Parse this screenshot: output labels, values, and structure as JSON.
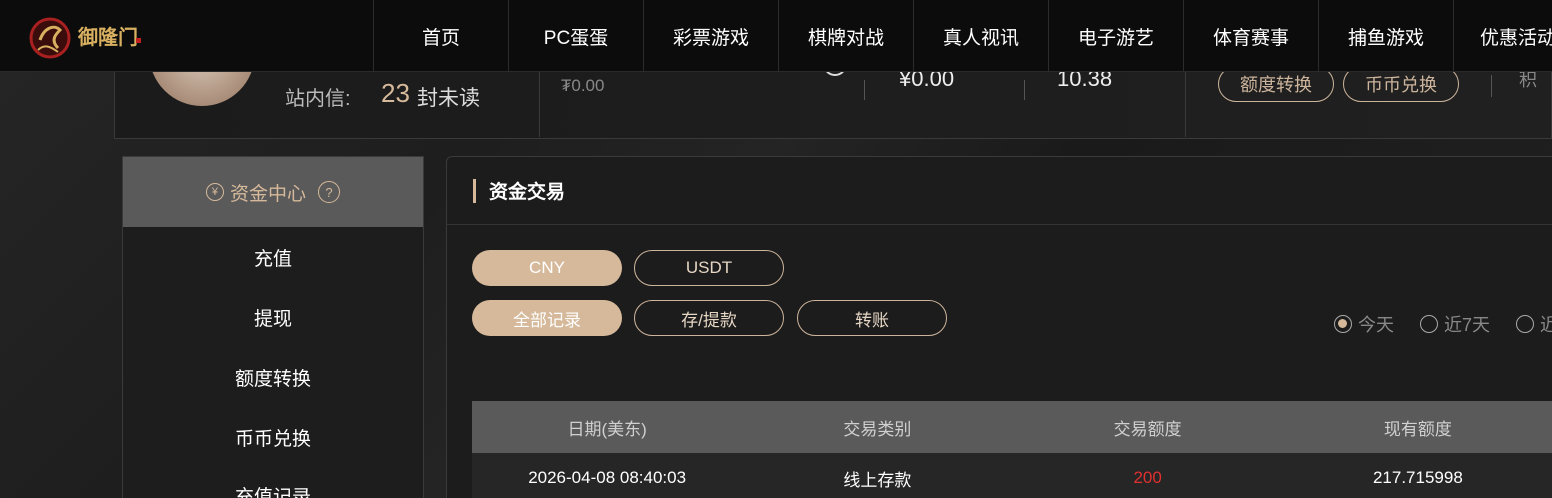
{
  "nav": {
    "items": [
      "首页",
      "PC蛋蛋",
      "彩票游戏",
      "棋牌对战",
      "真人视讯",
      "电子游艺",
      "体育赛事",
      "捕鱼游戏",
      "优惠活动"
    ],
    "logo_text": "御隆门"
  },
  "user": {
    "msg_label": "站内信:",
    "msg_count": "23",
    "msg_unread": "封未读",
    "balance_main": "₮0.00",
    "balance_cny": "¥0.00",
    "balance_other": "10.38",
    "btn_transfer": "额度转换",
    "btn_exchange": "币币兑换",
    "cut_text": "积"
  },
  "sidebar": {
    "title": "资金中心",
    "help": "?",
    "items": [
      "充值",
      "提现",
      "额度转换",
      "币币兑换",
      "充值记录"
    ]
  },
  "main": {
    "title": "资金交易",
    "currency": [
      "CNY",
      "USDT"
    ],
    "types": [
      "全部记录",
      "存/提款",
      "转账"
    ],
    "ranges": [
      "今天",
      "近7天",
      "近"
    ],
    "columns": [
      "日期(美东)",
      "交易类别",
      "交易额度",
      "现有额度"
    ],
    "rows": [
      {
        "date": "2026-04-08 08:40:03",
        "type": "线上存款",
        "amount": "200",
        "balance": "217.715998"
      }
    ]
  },
  "colors": {
    "accent": "#d6b99a",
    "negative": "#e03030",
    "header_bg": "#0c0c0c"
  }
}
